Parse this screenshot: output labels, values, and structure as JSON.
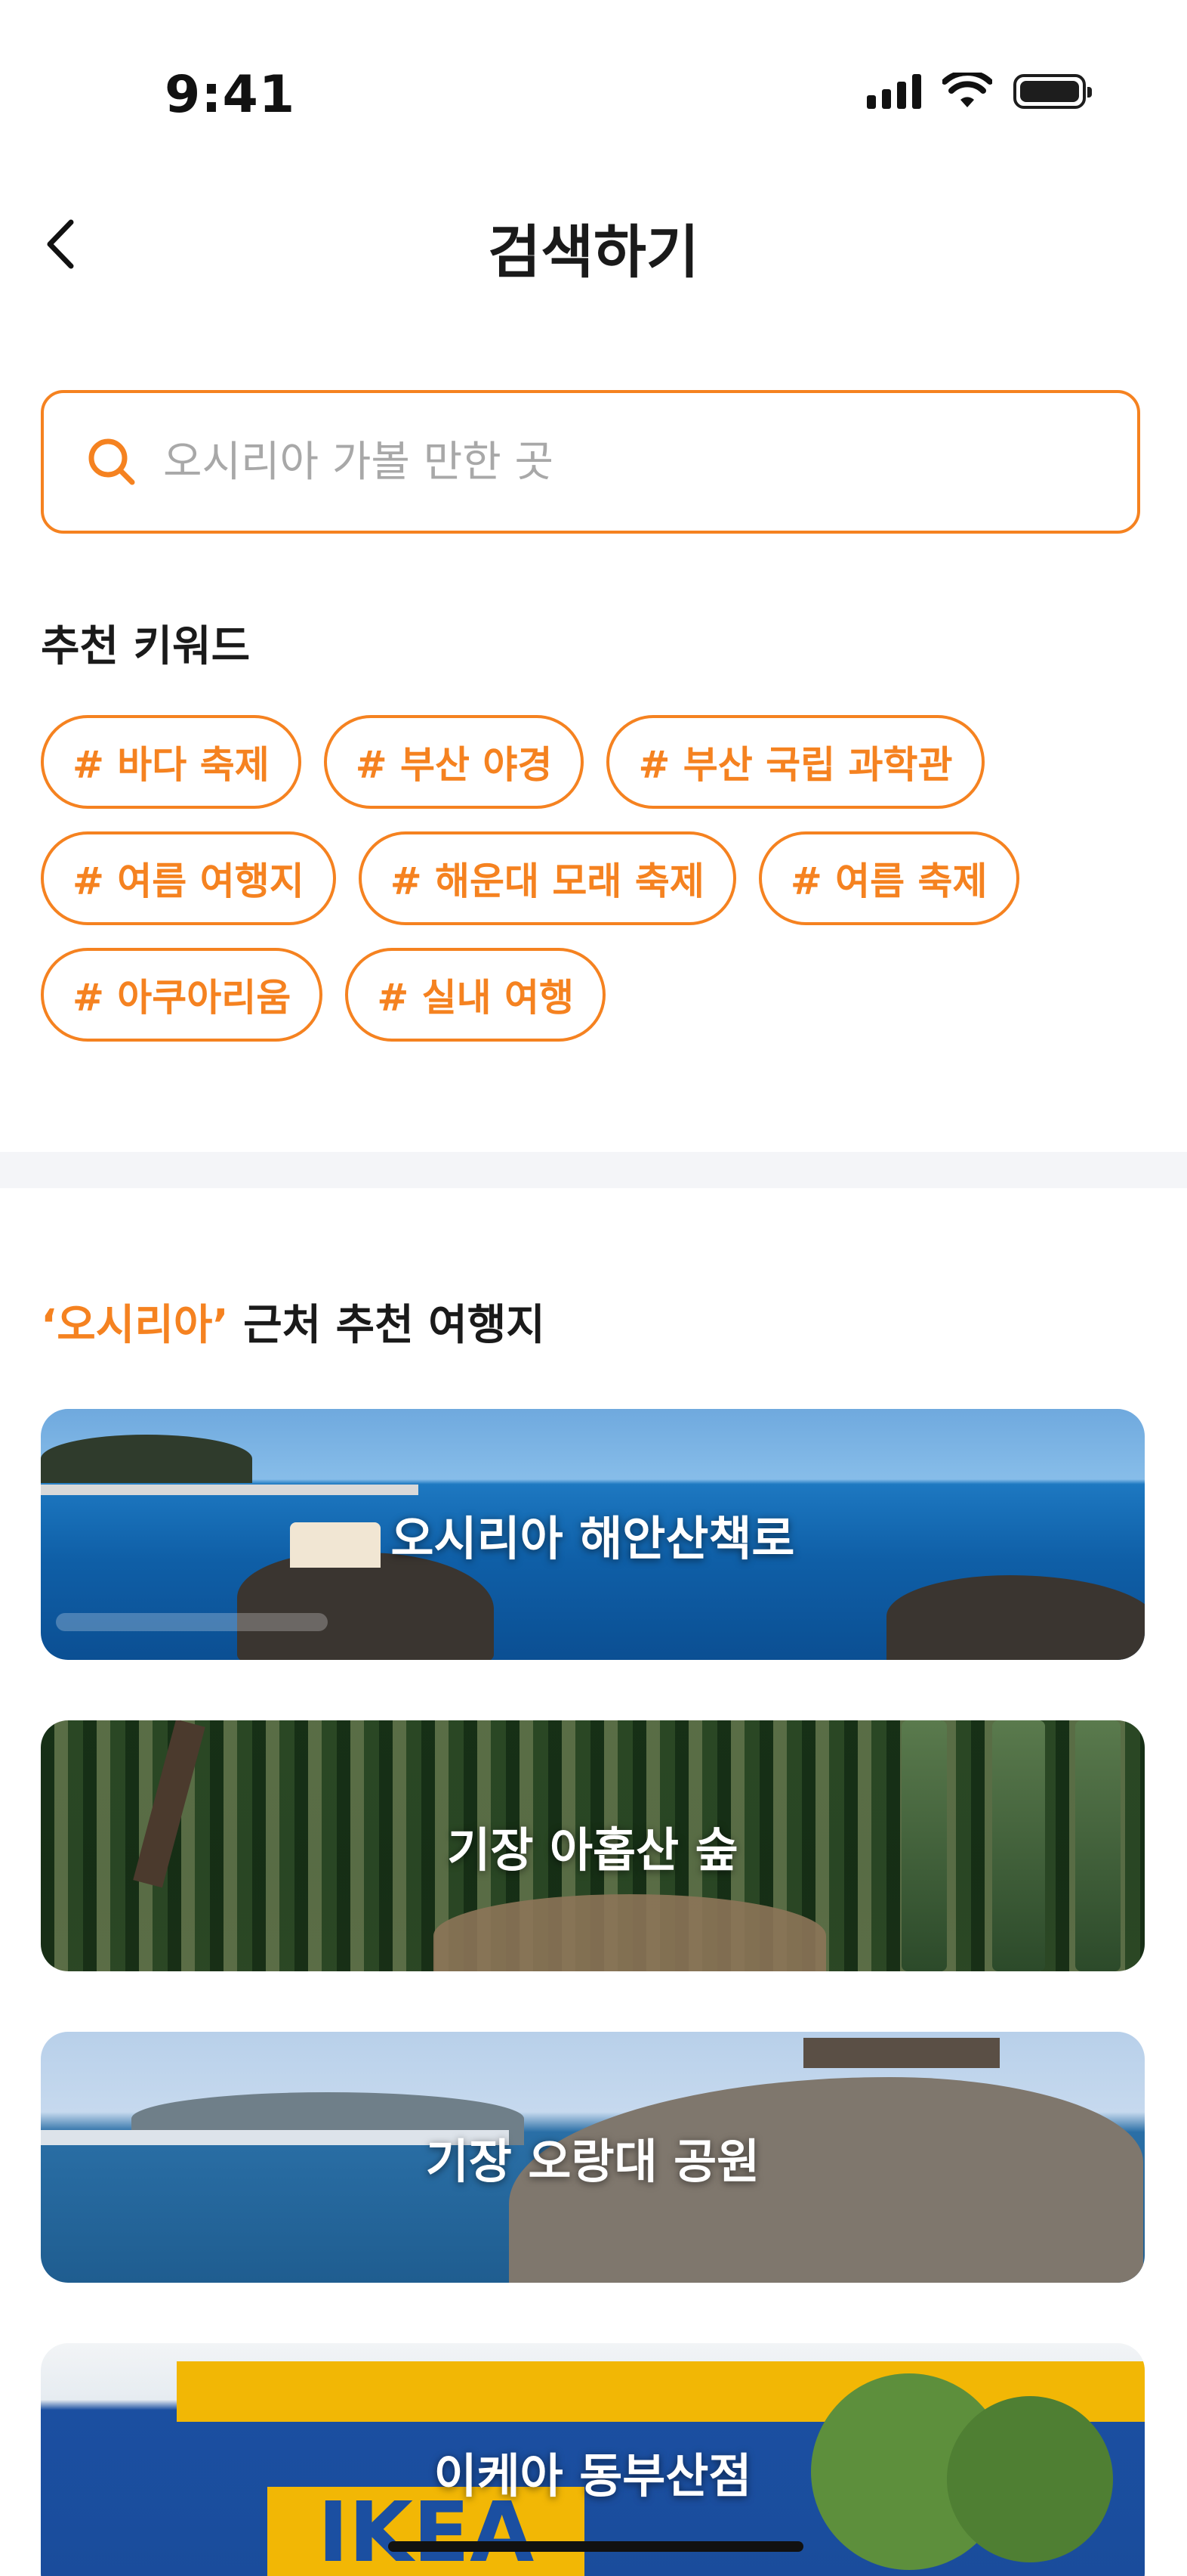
{
  "status_bar": {
    "time": "9:41"
  },
  "header": {
    "title": "검색하기"
  },
  "search": {
    "placeholder": "오시리아 가볼 만한 곳"
  },
  "keywords": {
    "title": "추천 키워드",
    "items": [
      "# 바다 축제",
      "# 부산 야경",
      "# 부산 국립 과학관",
      "# 여름 여행지",
      "# 해운대 모래 축제",
      "# 여름 축제",
      "# 아쿠아리움",
      "# 실내 여행"
    ]
  },
  "recommendations": {
    "title_highlight": "‘오시리아’",
    "title_rest": " 근처 추천 여행지",
    "places": [
      {
        "name": "오시리아 해안산책로"
      },
      {
        "name": "기장 아홉산 숲"
      },
      {
        "name": "기장 오랑대 공원"
      },
      {
        "name": "이케아 동부산점"
      }
    ]
  },
  "ikea_sign_text": "IKEA",
  "colors": {
    "accent": "#F58220",
    "divider": "#f4f5f8"
  }
}
